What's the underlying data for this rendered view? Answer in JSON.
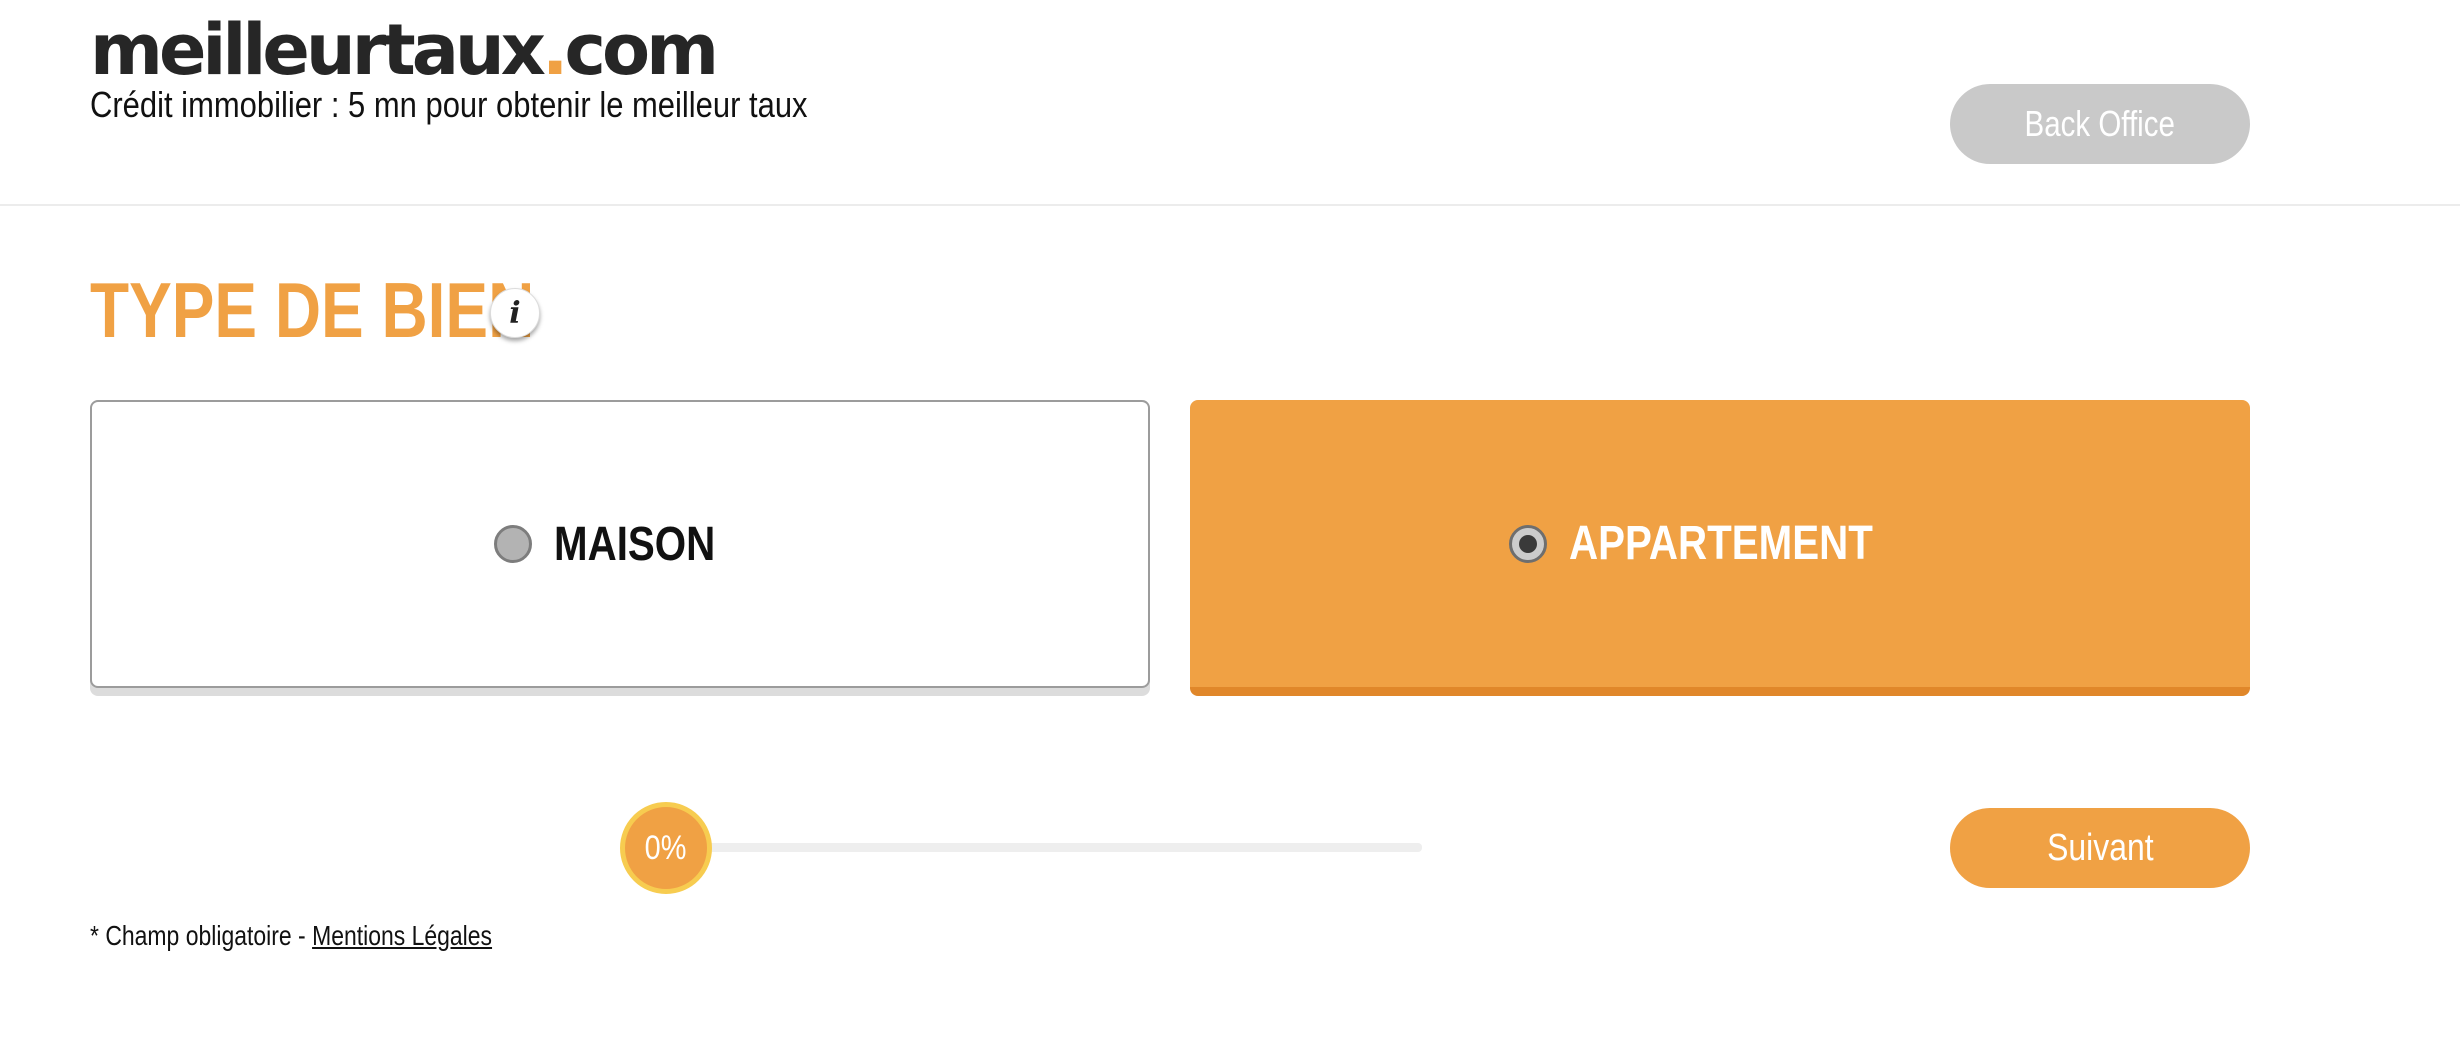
{
  "header": {
    "logo_main": "meilleurtaux",
    "logo_dot": ".",
    "logo_tld": "com",
    "tagline": "Crédit immobilier : 5 mn pour obtenir le meilleur taux",
    "back_office_label": "Back Office"
  },
  "form": {
    "section_title": "TYPE DE BIEN",
    "info_icon_glyph": "i",
    "options": [
      {
        "label": "MAISON",
        "selected": false
      },
      {
        "label": "APPARTEMENT",
        "selected": true
      }
    ]
  },
  "progress": {
    "percent_label": "0%",
    "value": 0
  },
  "navigation": {
    "next_label": "Suivant"
  },
  "footer": {
    "required_note": "* Champ obligatoire -",
    "legal_link": "Mentions Légales"
  },
  "colors": {
    "accent": "#f0a144",
    "accent_dark": "#e0872a",
    "disabled_button": "#c9c9c9",
    "knob_ring": "#f7cc50"
  },
  "icons": {
    "info": "info-icon",
    "radio_unchecked": "radio-unchecked-icon",
    "radio_checked": "radio-checked-icon"
  }
}
